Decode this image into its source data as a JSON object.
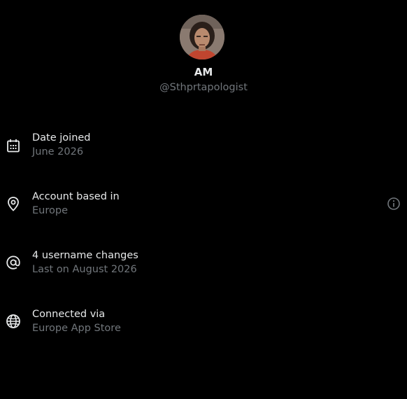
{
  "profile": {
    "display_name": "AM",
    "handle": "@Sthprtapologist",
    "avatar_icon": "profile-photo"
  },
  "rows": [
    {
      "icon": "calendar-icon",
      "title": "Date joined",
      "subtitle": "June 2026"
    },
    {
      "icon": "location-pin-icon",
      "title": "Account based in",
      "subtitle": "Europe",
      "trailing_icon": "info-icon"
    },
    {
      "icon": "at-sign-icon",
      "title": "4 username changes",
      "subtitle": "Last on August 2026"
    },
    {
      "icon": "globe-icon",
      "title": "Connected via",
      "subtitle": "Europe App Store"
    }
  ],
  "colors": {
    "background": "#000000",
    "primary_text": "#e7e9ea",
    "secondary_text": "#71767b"
  }
}
